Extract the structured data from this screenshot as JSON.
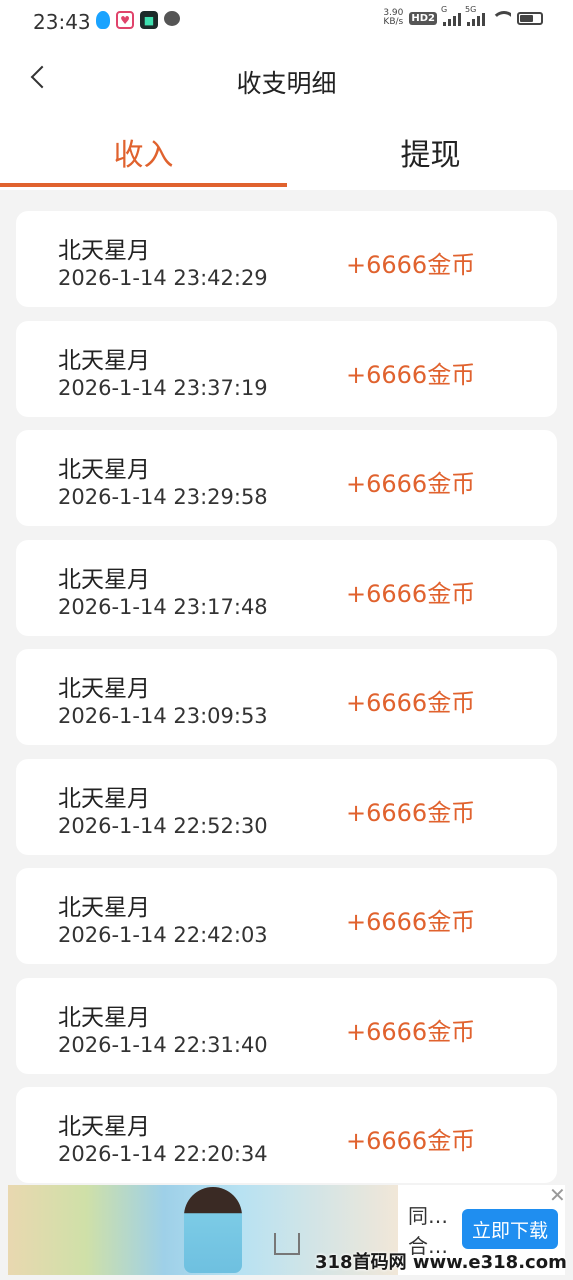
{
  "status_bar": {
    "time": "23:43",
    "net_speed": "3.90",
    "net_speed_unit": "KB/s",
    "hd_label": "HD2",
    "signal1_label": "G",
    "signal2_label": "5G"
  },
  "header": {
    "title": "收支明细"
  },
  "tabs": [
    {
      "label": "收入",
      "active": true
    },
    {
      "label": "提现",
      "active": false
    }
  ],
  "records": [
    {
      "name": "北天星月",
      "datetime": "2026-1-14 23:42:29",
      "amount": "+6666金币"
    },
    {
      "name": "北天星月",
      "datetime": "2026-1-14 23:37:19",
      "amount": "+6666金币"
    },
    {
      "name": "北天星月",
      "datetime": "2026-1-14 23:29:58",
      "amount": "+6666金币"
    },
    {
      "name": "北天星月",
      "datetime": "2026-1-14 23:17:48",
      "amount": "+6666金币"
    },
    {
      "name": "北天星月",
      "datetime": "2026-1-14 23:09:53",
      "amount": "+6666金币"
    },
    {
      "name": "北天星月",
      "datetime": "2026-1-14 22:52:30",
      "amount": "+6666金币"
    },
    {
      "name": "北天星月",
      "datetime": "2026-1-14 22:42:03",
      "amount": "+6666金币"
    },
    {
      "name": "北天星月",
      "datetime": "2026-1-14 22:31:40",
      "amount": "+6666金币"
    },
    {
      "name": "北天星月",
      "datetime": "2026-1-14 22:20:34",
      "amount": "+6666金币"
    }
  ],
  "ad": {
    "text": "同…合…",
    "button_label": "立即下载",
    "close_symbol": "✕"
  },
  "watermark": "318首码网 www.e318.com",
  "colors": {
    "accent": "#e0622e",
    "ad_button": "#1f8ef0",
    "background": "#f3f3f3"
  }
}
